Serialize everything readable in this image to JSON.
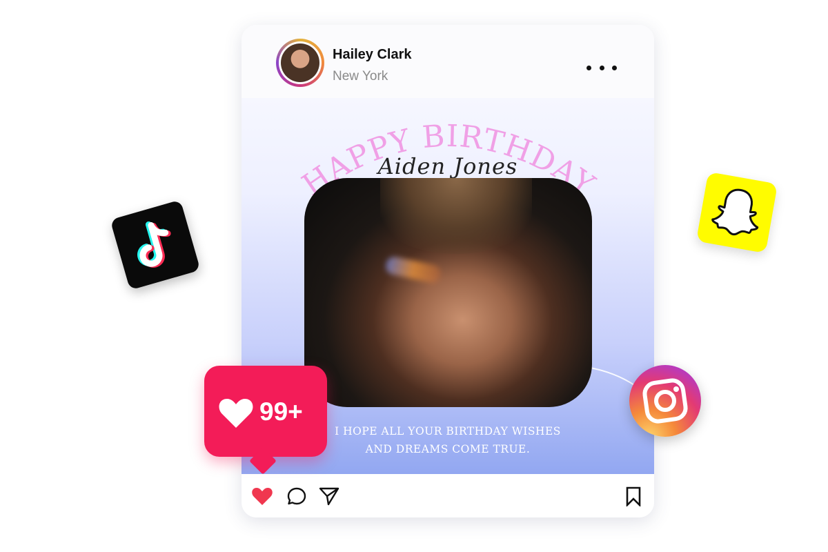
{
  "post": {
    "author_name": "Hailey Clark",
    "author_location": "New York",
    "greeting": "HAPPY BIRTHDAY",
    "recipient_name": "Aiden Jones",
    "wishes_line1": "I HOPE ALL YOUR BIRTHDAY WISHES",
    "wishes_line2": "AND DREAMS COME TRUE.",
    "like_count": "99+"
  },
  "icons": {
    "more": "more-options-icon",
    "like": "heart-icon",
    "comment": "comment-icon",
    "share": "send-icon",
    "save": "bookmark-icon"
  },
  "stickers": [
    "tiktok-logo",
    "snapchat-logo",
    "instagram-logo"
  ],
  "colors": {
    "greeting": "#f0a0e6",
    "like_badge": "#f31c58",
    "like_icon": "#f0374f",
    "snapchat": "#fffc00"
  }
}
